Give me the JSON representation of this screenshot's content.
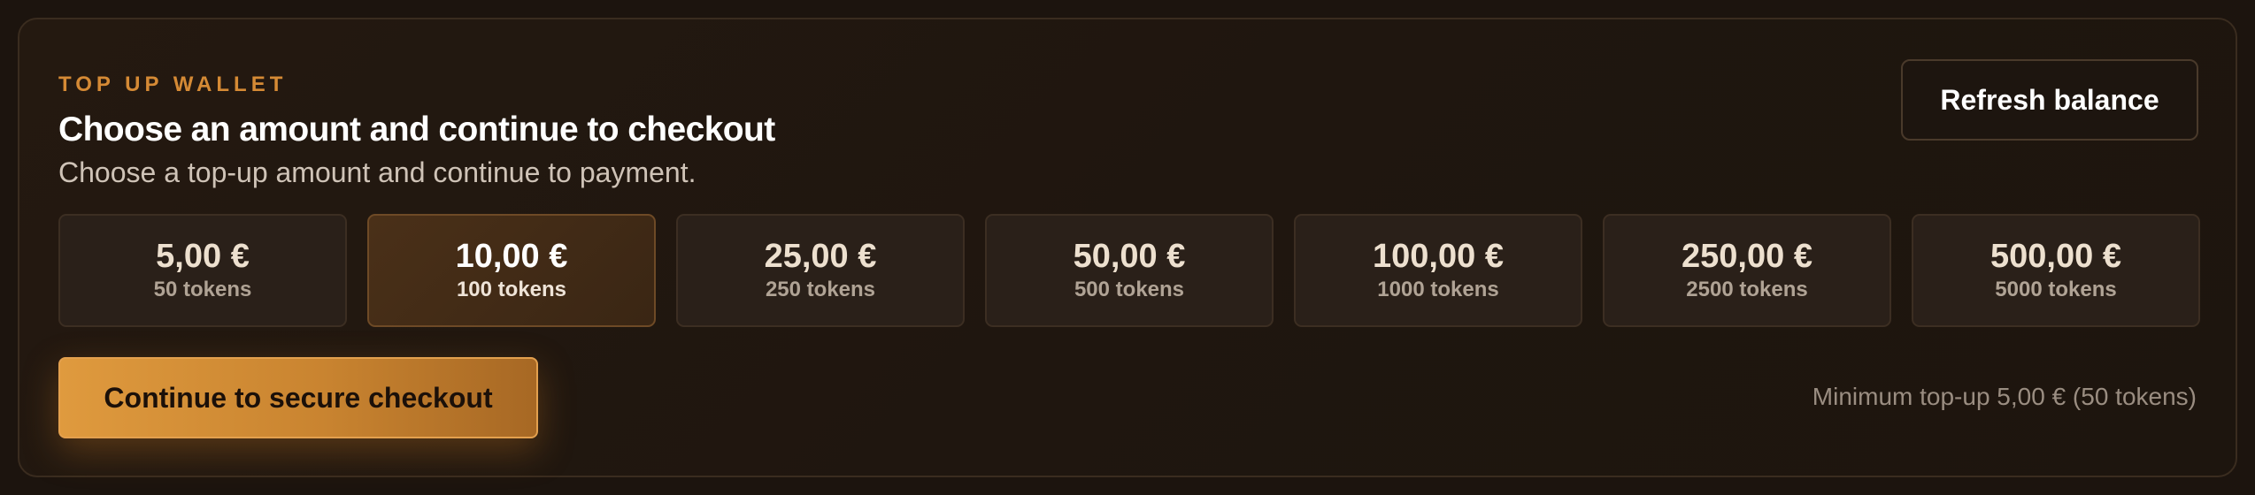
{
  "wallet": {
    "eyebrow": "TOP UP WALLET",
    "title": "Choose an amount and continue to checkout",
    "subtitle": "Choose a top-up amount and continue to payment.",
    "refresh_label": "Refresh balance"
  },
  "amounts": [
    {
      "price": "5,00 €",
      "tokens": "50 tokens",
      "selected": false
    },
    {
      "price": "10,00 €",
      "tokens": "100 tokens",
      "selected": true
    },
    {
      "price": "25,00 €",
      "tokens": "250 tokens",
      "selected": false
    },
    {
      "price": "50,00 €",
      "tokens": "500 tokens",
      "selected": false
    },
    {
      "price": "100,00 €",
      "tokens": "1000 tokens",
      "selected": false
    },
    {
      "price": "250,00 €",
      "tokens": "2500 tokens",
      "selected": false
    },
    {
      "price": "500,00 €",
      "tokens": "5000 tokens",
      "selected": false
    }
  ],
  "checkout": {
    "button_label": "Continue to secure checkout",
    "minimum_note": "Minimum top-up 5,00 € (50 tokens)"
  },
  "colors": {
    "accent": "#d58a35",
    "background": "#1c140e",
    "selected_card": "#4a3018"
  }
}
